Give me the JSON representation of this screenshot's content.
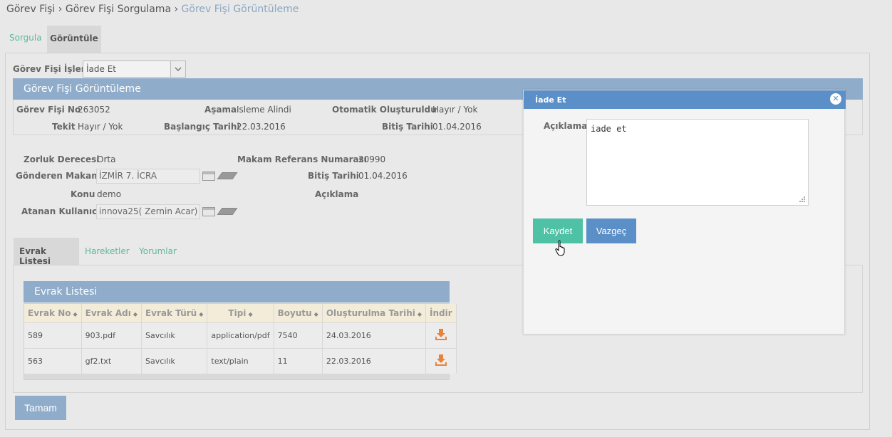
{
  "breadcrumb": {
    "item1": "Görev Fişi",
    "sep1": "›",
    "item2": "Görev Fişi Sorgulama",
    "sep2": "›",
    "current": "Görev Fişi Görüntüleme"
  },
  "top_tabs": {
    "sorgula": "Sorgula",
    "goruntule": "Görüntüle"
  },
  "islem": {
    "label": "Görev Fişi İşlem",
    "selected": "İade Et"
  },
  "section": {
    "title": "Görev Fişi Görüntüleme",
    "gorev_fisi_no": {
      "label": "Görev Fişi No",
      "value": "263052"
    },
    "asama": {
      "label": "Aşama",
      "value": "Isleme Alindi"
    },
    "otomatik": {
      "label": "Otomatik Oluşturuldu",
      "value": "Hayır / Yok"
    },
    "tekit": {
      "label": "Tekit",
      "value": "Hayır / Yok"
    },
    "baslangic": {
      "label": "Başlangıç Tarihi",
      "value": "22.03.2016"
    },
    "bitis": {
      "label": "Bitiş Tarihi",
      "value": "01.04.2016"
    }
  },
  "details": {
    "zorluk": {
      "label": "Zorluk Derecesi",
      "value": "Orta"
    },
    "makam_ref": {
      "label": "Makam Referans Numarası",
      "value": "20990"
    },
    "gonderen": {
      "label": "Gönderen Makam",
      "value": "İZMİR 7. İCRA"
    },
    "bitis2": {
      "label": "Bitiş Tarihi",
      "value": "01.04.2016"
    },
    "konu": {
      "label": "Konu",
      "value": "demo"
    },
    "aciklama": {
      "label": "Açıklama"
    },
    "atanan": {
      "label": "Atanan Kullanıcı",
      "value": "innova25( Zernin Acar)"
    }
  },
  "sub_tabs": {
    "evrak": "Evrak Listesi",
    "hareketler": "Hareketler",
    "yorumlar": "Yorumlar"
  },
  "evrak_grid": {
    "title": "Evrak Listesi",
    "columns": [
      "Evrak No",
      "Evrak Adı",
      "Evrak Türü",
      "Tipi",
      "Boyutu",
      "Oluşturulma Tarihi",
      "İndir"
    ],
    "rows": [
      [
        "589",
        "903.pdf",
        "Savcılık",
        "application/pdf",
        "7540",
        "24.03.2016"
      ],
      [
        "563",
        "gf2.txt",
        "Savcılık",
        "text/plain",
        "11",
        "22.03.2016"
      ]
    ]
  },
  "tamam_label": "Tamam",
  "dialog": {
    "title": "İade Et",
    "close": "✕",
    "aciklama_label": "Açıklama",
    "aciklama_value": "iade et",
    "kaydet": "Kaydet",
    "vazgec": "Vazgeç"
  },
  "colors": {
    "header_blue": "#8facca",
    "dialog_blue": "#5b8fc7",
    "green": "#4fc1a5",
    "download_orange": "#e8833a"
  }
}
